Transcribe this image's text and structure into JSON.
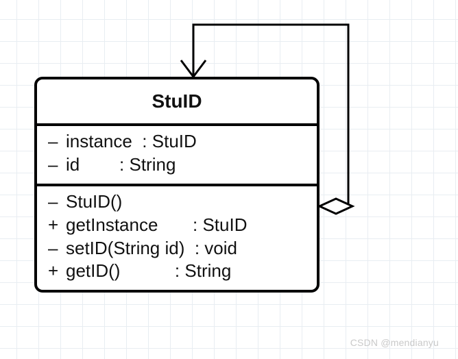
{
  "class": {
    "name": "StuID",
    "attributes": [
      {
        "vis": "–",
        "name": "instance",
        "type": "StuID"
      },
      {
        "vis": "–",
        "name": "id",
        "type": "String"
      }
    ],
    "operations": [
      {
        "vis": "–",
        "sig": "StuID()",
        "ret": ""
      },
      {
        "vis": "+",
        "sig": "getInstance",
        "ret": "StuID"
      },
      {
        "vis": "–",
        "sig": "setID(String id)",
        "ret": "void"
      },
      {
        "vis": "+",
        "sig": "getID()",
        "ret": "String"
      }
    ]
  },
  "layout": {
    "attr_name_width_ch": 9,
    "op_sig_width_ch": 17
  },
  "watermark": "CSDN @mendianyu"
}
